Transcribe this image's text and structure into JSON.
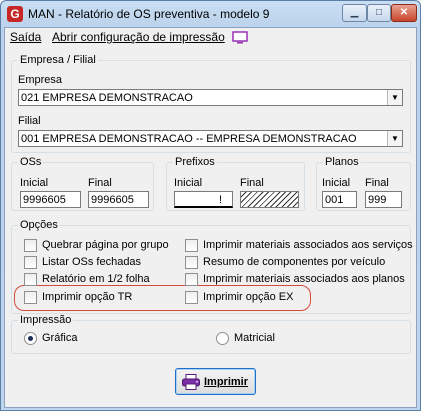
{
  "window": {
    "app_icon_letter": "G",
    "title": "MAN - Relatório de OS preventiva -  modelo 9",
    "minimize_symbol": "▁",
    "maximize_symbol": "□",
    "close_symbol": "✕"
  },
  "menu": {
    "saida": "Saída",
    "config": "Abrir configuração de impressão",
    "monitor_icon": "monitor-icon"
  },
  "empresa_filial": {
    "legend": "Empresa / Filial",
    "empresa_label": "Empresa",
    "empresa_value": "021 EMPRESA DEMONSTRACAO",
    "filial_label": "Filial",
    "filial_value": "001 EMPRESA DEMONSTRACAO -- EMPRESA DEMONSTRACAO",
    "dropdown_symbol": "▼"
  },
  "oss": {
    "legend": "OSs",
    "inicial_label": "Inicial",
    "inicial_value": "9996605",
    "final_label": "Final",
    "final_value": "9996605"
  },
  "prefixos": {
    "legend": "Prefixos",
    "inicial_label": "Inicial",
    "inicial_value": "!",
    "final_label": "Final",
    "final_value": ""
  },
  "planos": {
    "legend": "Planos",
    "inicial_label": "Inicial",
    "inicial_value": "001",
    "final_label": "Final",
    "final_value": "999"
  },
  "opcoes": {
    "legend": "Opções",
    "left": [
      {
        "label": "Quebrar página por grupo",
        "checked": false
      },
      {
        "label": "Listar OSs fechadas",
        "checked": false
      },
      {
        "label": "Relatório em 1/2 folha",
        "checked": false
      },
      {
        "label": "Imprimir opção TR",
        "checked": false
      }
    ],
    "right": [
      {
        "label": "Imprimir materiais associados aos serviços",
        "checked": false
      },
      {
        "label": "Resumo de componentes por veículo",
        "checked": false
      },
      {
        "label": "Imprimir materiais associados aos planos",
        "checked": false
      },
      {
        "label": "Imprimir opção EX",
        "checked": false
      }
    ]
  },
  "impressao": {
    "legend": "Impressão",
    "grafica": "Gráfica",
    "matricial": "Matricial",
    "selected": "Gráfica"
  },
  "imprimir_button": "Imprimir",
  "colors": {
    "highlight": "#d34b3b",
    "close_button": "#c8442a",
    "print_icon": "#7b2fa6"
  }
}
